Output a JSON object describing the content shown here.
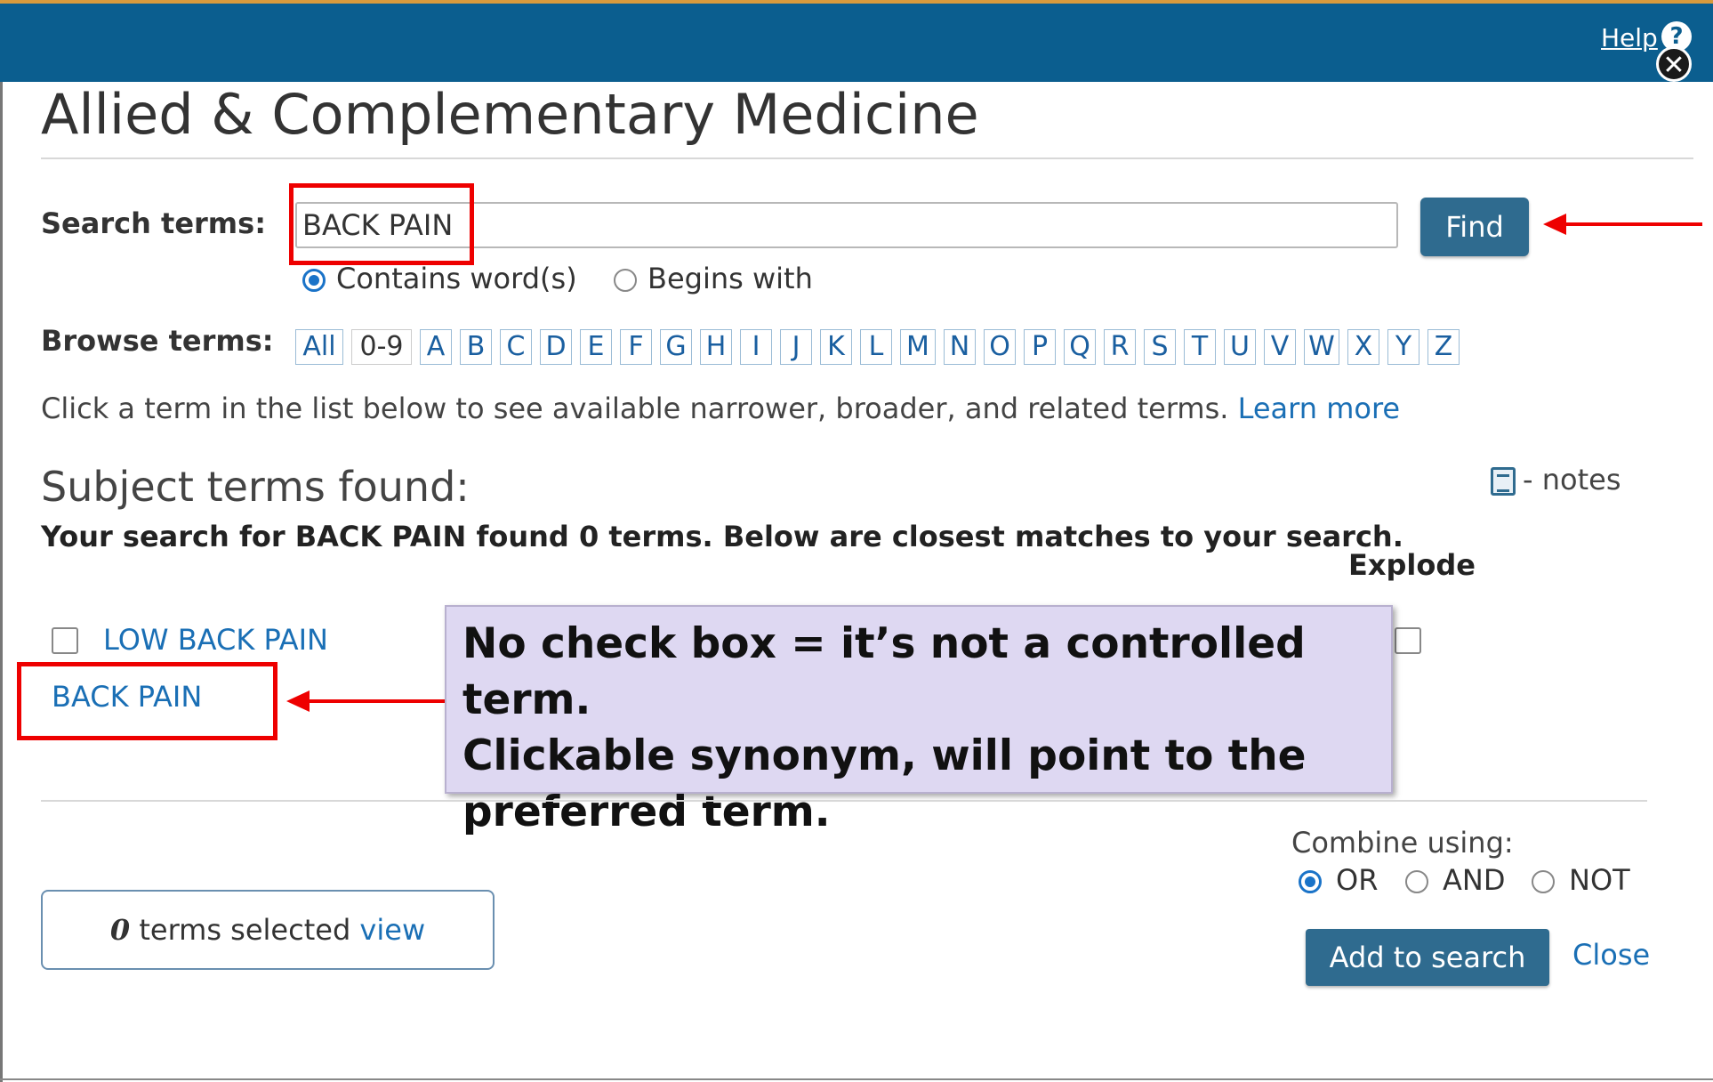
{
  "header": {
    "help_label": "Help",
    "help_icon": "?",
    "close_icon": "✕"
  },
  "title": "Allied & Complementary Medicine",
  "search": {
    "label": "Search terms:",
    "value": "BACK PAIN",
    "find_label": "Find",
    "options": [
      {
        "label": "Contains word(s)",
        "checked": true
      },
      {
        "label": "Begins with",
        "checked": false
      }
    ]
  },
  "browse": {
    "label": "Browse terms:",
    "letters": [
      "All",
      "0-9",
      "A",
      "B",
      "C",
      "D",
      "E",
      "F",
      "G",
      "H",
      "I",
      "J",
      "K",
      "L",
      "M",
      "N",
      "O",
      "P",
      "Q",
      "R",
      "S",
      "T",
      "U",
      "V",
      "W",
      "X",
      "Y",
      "Z"
    ]
  },
  "info": {
    "text": "Click a term in the list below to see available narrower, broader, and related terms.",
    "learn_more": "Learn more"
  },
  "subject": {
    "heading": "Subject terms found:",
    "notes_label": "- notes",
    "found_message": "Your search for BACK PAIN found 0 terms. Below are closest matches to your search.",
    "explode_label": "Explode",
    "terms": [
      {
        "label": "LOW BACK PAIN",
        "has_checkbox": true
      },
      {
        "label": "BACK PAIN",
        "has_checkbox": false
      }
    ]
  },
  "callout": {
    "lines": [
      "No check box = it’s not a controlled term.",
      "Clickable synonym, will point to the",
      "preferred term."
    ]
  },
  "combine": {
    "label": "Combine using:",
    "options": [
      {
        "label": "OR",
        "checked": true
      },
      {
        "label": "AND",
        "checked": false
      },
      {
        "label": "NOT",
        "checked": false
      }
    ]
  },
  "footer": {
    "selected_count": "0",
    "selected_text": "terms selected",
    "view_label": "view",
    "add_label": "Add to search",
    "close_label": "Close"
  },
  "colors": {
    "header_bar": "#0b5e8f",
    "button": "#2f6b8f",
    "link": "#1a6fb5",
    "annotation_red": "#ee0000",
    "callout_bg": "#ded8f2"
  }
}
